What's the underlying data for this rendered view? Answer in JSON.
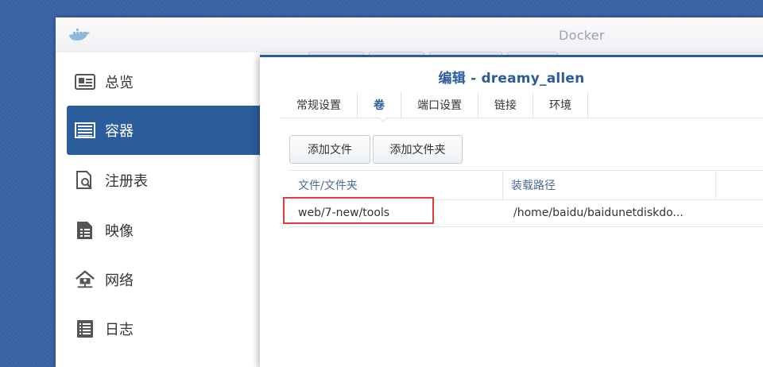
{
  "app": {
    "title": "Docker",
    "logo_icon": "docker-whale-icon"
  },
  "sidebar": {
    "items": [
      {
        "label": "总览",
        "icon": "overview-card-icon",
        "active": false
      },
      {
        "label": "容器",
        "icon": "container-list-icon",
        "active": true
      },
      {
        "label": "注册表",
        "icon": "registry-search-icon",
        "active": false
      },
      {
        "label": "映像",
        "icon": "image-document-icon",
        "active": false
      },
      {
        "label": "网络",
        "icon": "network-house-icon",
        "active": false
      },
      {
        "label": "日志",
        "icon": "log-list-icon",
        "active": false
      }
    ]
  },
  "dialog": {
    "title": "编辑 - dreamy_allen",
    "tabs": [
      {
        "label": "常规设置",
        "active": false
      },
      {
        "label": "卷",
        "active": true
      },
      {
        "label": "端口设置",
        "active": false
      },
      {
        "label": "链接",
        "active": false
      },
      {
        "label": "环境",
        "active": false
      }
    ],
    "buttons": {
      "add_file": "添加文件",
      "add_folder": "添加文件夹"
    },
    "table": {
      "headers": [
        "文件/文件夹",
        "装载路径"
      ],
      "rows": [
        {
          "file": "web/7-new/tools",
          "mount_path": "/home/baidu/baidunetdiskdo..."
        }
      ]
    }
  },
  "colors": {
    "accent": "#2b5c9b",
    "highlight": "#e03c3c",
    "desktop": "#3a63a8"
  }
}
